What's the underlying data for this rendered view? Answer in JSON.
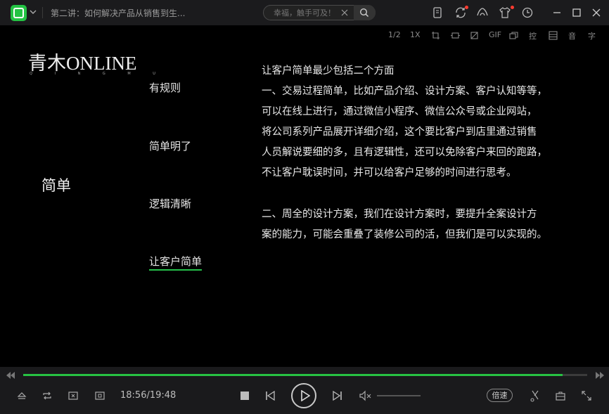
{
  "titlebar": {
    "video_title": "第二讲：如何解决产品从销售到生...",
    "search_placeholder": "幸福，触手可及！"
  },
  "toolbar2": {
    "ratio_label": "1/2",
    "speed_label": "1X",
    "gif_label": "GIF",
    "control_label": "控",
    "audio_label": "音",
    "subtitle_label": "字"
  },
  "video": {
    "brand": "青木ONLINE",
    "brand_sub": "Q I N G M U",
    "main_title": "简单",
    "nav_items": [
      "有规则",
      "简单明了",
      "逻辑清晰",
      "让客户简单"
    ],
    "body_lines": [
      "让客户简单最少包括二个方面",
      "一、交易过程简单，比如产品介绍、设计方案、客户认知等等，",
      "可以在线上进行，通过微信小程序、微信公众号或企业网站，",
      "将公司系列产品展开详细介绍，这个要比客户到店里通过销售",
      "人员解说要细的多，且有逻辑性，还可以免除客户来回的跑路，",
      "不让客户耽误时间，并可以给客户足够的时间进行思考。",
      "",
      "二、周全的设计方案，我们在设计方案时，要提升全案设计方",
      "案的能力，可能会重叠了装修公司的活，但我们是可以实现的。"
    ]
  },
  "playback": {
    "time": "18:56/19:48",
    "progress": 0.956,
    "speed_button": "倍速"
  },
  "colors": {
    "accent": "#27c243",
    "background": "#000000",
    "bar": "#1a1a1c"
  }
}
